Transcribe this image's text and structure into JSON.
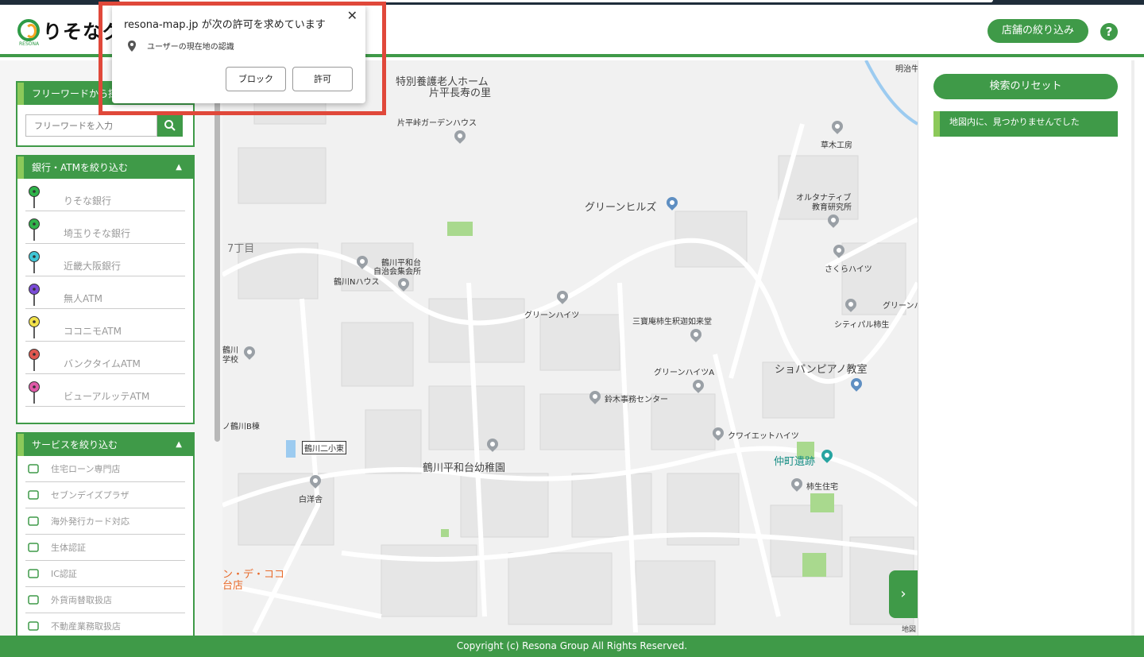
{
  "header": {
    "logo_text": "りそなグ",
    "logo_sub": "RESONA",
    "filter_button": "店舗の絞り込み",
    "help_button": "?"
  },
  "dialog": {
    "title": "resona-map.jp が次の許可を求めています",
    "close": "✕",
    "permission": "ユーザーの現在地の認識",
    "block_button": "ブロック",
    "allow_button": "許可"
  },
  "sidebar": {
    "freeword": {
      "heading": "フリーワードから探",
      "placeholder": "フリーワードを入力"
    },
    "banks": {
      "heading": "銀行・ATMを絞り込む",
      "toggle": "▲",
      "items": [
        {
          "label": "りそな銀行",
          "color": "#2fb34a"
        },
        {
          "label": "埼玉りそな銀行",
          "color": "#2fb34a"
        },
        {
          "label": "近畿大阪銀行",
          "color": "#3fc6d6"
        },
        {
          "label": "無人ATM",
          "color": "#7a4bd6"
        },
        {
          "label": "ココニモATM",
          "color": "#f2e24a"
        },
        {
          "label": "バンクタイムATM",
          "color": "#e0574f"
        },
        {
          "label": "ビューアルッテATM",
          "color": "#e05aa8"
        }
      ]
    },
    "services": {
      "heading": "サービスを絞り込む",
      "toggle": "▲",
      "items": [
        {
          "label": "住宅ローン専門店",
          "icon": "house-icon"
        },
        {
          "label": "セブンデイズプラザ",
          "icon": "seven-days-icon"
        },
        {
          "label": "海外発行カード対応",
          "icon": "card-icon"
        },
        {
          "label": "生体認証",
          "icon": "fingerprint-icon"
        },
        {
          "label": "IC認証",
          "icon": "ic-card-icon"
        },
        {
          "label": "外貨両替取扱店",
          "icon": "currency-icon"
        },
        {
          "label": "不動産業務取扱店",
          "icon": "building-icon"
        }
      ]
    }
  },
  "map": {
    "labels": {
      "nursing_home_1": "特別養護老人ホーム",
      "nursing_home_2": "片平長寿の里",
      "garden_house": "片平峠ガーデンハウス",
      "green_hills": "グリーンヒルズ",
      "kusaki": "草木工房",
      "meiji": "明治牛",
      "alt_edu_1": "オルタナティブ",
      "alt_edu_2": "教育研究所",
      "sakura": "さくらハイツ",
      "chome7": "7丁目",
      "tsurukawa_heiwadai_1": "鶴川平和台",
      "tsurukawa_heiwadai_2": "自治会集会所",
      "tsurukawa_n": "鶴川Nハウス",
      "green_heights": "グリーンハイツ",
      "sanpo": "三寶庵柿生釈迦如来堂",
      "green_right": "グリーンハ",
      "city_pal": "シティパル柿生",
      "tsurukawa_school_1": "鶴川",
      "tsurukawa_school_2": "学校",
      "green_heights_a": "グリーンハイツA",
      "chopin": "ショパンピアノ教室",
      "suzuki": "鈴木事務センター",
      "quiet": "クワイエットハイツ",
      "nakamachi": "仲町遺跡",
      "kakio_house": "柿生住宅",
      "tsurukawa_b": "ノ鶴川B棟",
      "tsurukawa_2_east": "鶴川二小東",
      "kindergarten": "鶴川平和台幼稚園",
      "hakuyo": "白洋舎",
      "coco_1": "ン・デ・ココ",
      "coco_2": "台店",
      "map_data": "地図"
    },
    "next_arrow": "›"
  },
  "right_panel": {
    "reset_button": "検索のリセット",
    "not_found": "地図内に、見つかりませんでした"
  },
  "footer": {
    "copyright": "Copyright (c) Resona Group All Rights Reserved."
  }
}
